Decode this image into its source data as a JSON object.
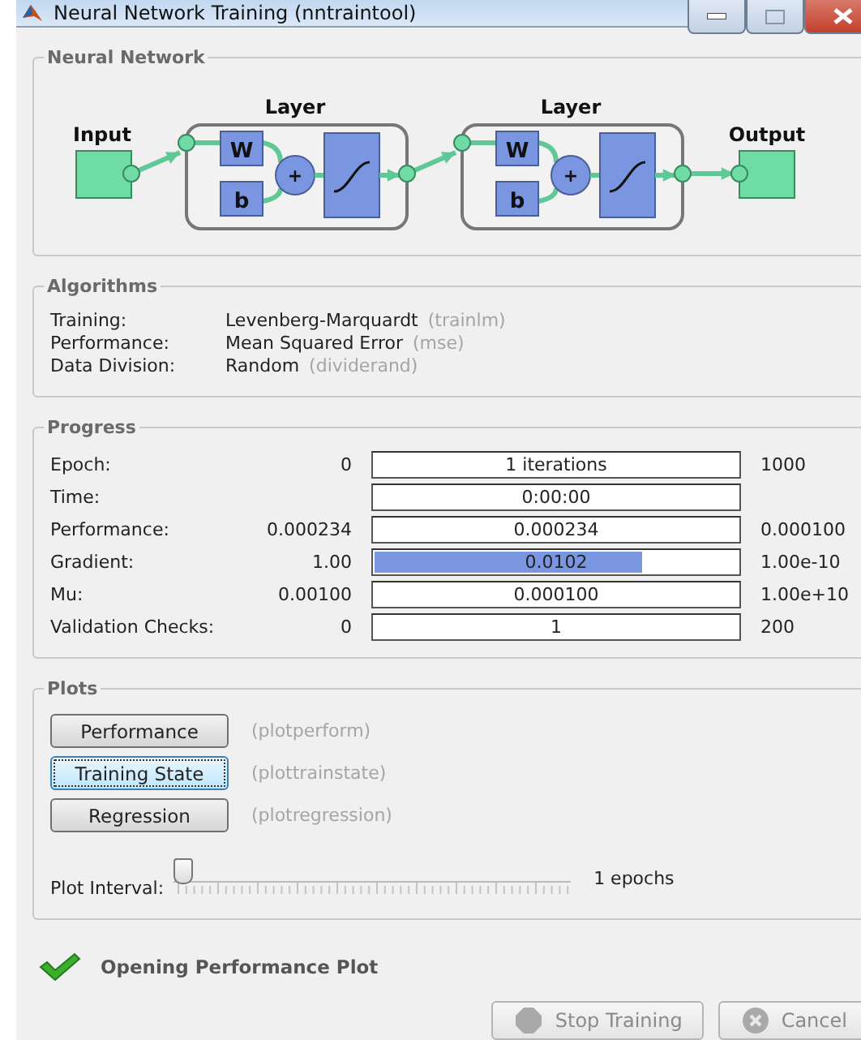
{
  "window": {
    "title": "Neural Network Training (nntraintool)"
  },
  "network": {
    "legend": "Neural Network",
    "input_label": "Input",
    "output_label": "Output",
    "layers": [
      {
        "label": "Layer",
        "weight": "W",
        "bias": "b",
        "sum": "+"
      },
      {
        "label": "Layer",
        "weight": "W",
        "bias": "b",
        "sum": "+"
      }
    ]
  },
  "algorithms": {
    "legend": "Algorithms",
    "rows": [
      {
        "label": "Training:",
        "value": "Levenberg-Marquardt",
        "function": "(trainlm)"
      },
      {
        "label": "Performance:",
        "value": "Mean Squared Error",
        "function": "(mse)"
      },
      {
        "label": "Data Division:",
        "value": "Random",
        "function": "(dividerand)"
      }
    ]
  },
  "progress": {
    "legend": "Progress",
    "rows": [
      {
        "label": "Epoch:",
        "start": "0",
        "bar": "1 iterations",
        "end": "1000"
      },
      {
        "label": "Time:",
        "bar": "0:00:00"
      },
      {
        "label": "Performance:",
        "start": "0.000234",
        "bar": "0.000234",
        "end": "0.000100"
      },
      {
        "label": "Gradient:",
        "start": "1.00",
        "bar": "0.0102",
        "level": 0.74,
        "end": "1.00e-10"
      },
      {
        "label": "Mu:",
        "start": "0.00100",
        "bar": "0.000100",
        "end": "1.00e+10"
      },
      {
        "label": "Validation Checks:",
        "start": "0",
        "bar": "1",
        "end": "200"
      }
    ]
  },
  "plots": {
    "legend": "Plots",
    "buttons": [
      {
        "label": "Performance",
        "function": "(plotperform)",
        "selected": false
      },
      {
        "label": "Training State",
        "function": "(plottrainstate)",
        "selected": true
      },
      {
        "label": "Regression",
        "function": "(plotregression)",
        "selected": false
      }
    ],
    "slider": {
      "label": "Plot Interval:",
      "level": 0,
      "reading": "1 epochs"
    }
  },
  "status": {
    "text": "Opening Performance Plot"
  },
  "buttons": [
    {
      "label": "Stop Training",
      "kind": "stop",
      "disabled": true
    },
    {
      "label": "Cancel",
      "kind": "cancel",
      "disabled": true
    }
  ]
}
